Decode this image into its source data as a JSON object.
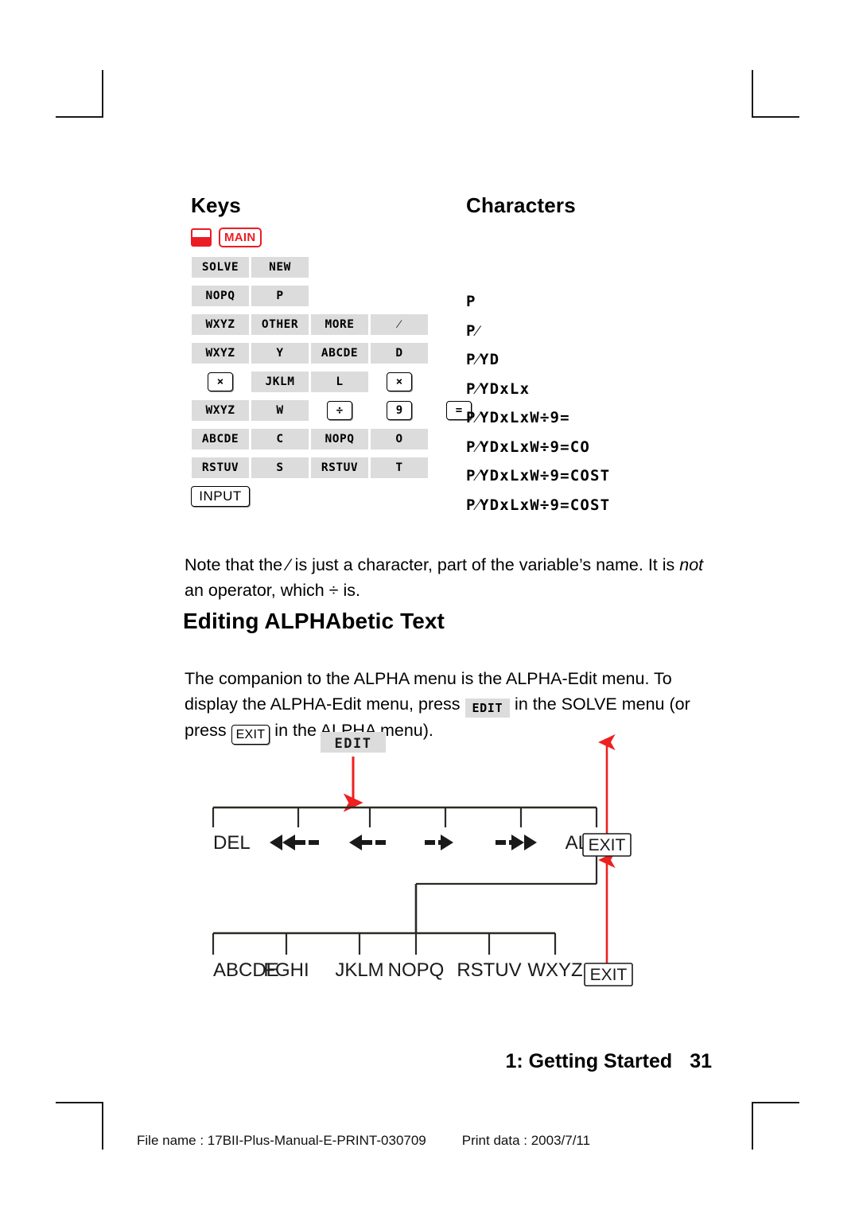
{
  "columns": {
    "keys_header": "Keys",
    "characters_header": "Characters"
  },
  "shift_row": {
    "shift_icon": "shift-indicator",
    "main_key": "MAIN"
  },
  "key_rows": [
    {
      "keys": [
        {
          "label": "SOLVE",
          "type": "soft"
        },
        {
          "label": "NEW",
          "type": "soft"
        }
      ],
      "character": ""
    },
    {
      "keys": [
        {
          "label": "NOPQ",
          "type": "soft"
        },
        {
          "label": "P",
          "type": "soft"
        }
      ],
      "character": "P"
    },
    {
      "keys": [
        {
          "label": "WXYZ",
          "type": "soft"
        },
        {
          "label": "OTHER",
          "type": "soft"
        },
        {
          "label": "MORE",
          "type": "soft"
        },
        {
          "label": "⁄",
          "type": "soft"
        }
      ],
      "character": "P⁄"
    },
    {
      "keys": [
        {
          "label": "WXYZ",
          "type": "soft"
        },
        {
          "label": "Y",
          "type": "soft"
        },
        {
          "label": "ABCDE",
          "type": "soft"
        },
        {
          "label": "D",
          "type": "soft"
        }
      ],
      "character": "P⁄YD"
    },
    {
      "keys": [
        {
          "label": "×",
          "type": "hard"
        },
        {
          "label": "JKLM",
          "type": "soft"
        },
        {
          "label": "L",
          "type": "soft"
        },
        {
          "label": "×",
          "type": "hard"
        }
      ],
      "character": "P⁄YDxLx"
    },
    {
      "keys": [
        {
          "label": "WXYZ",
          "type": "soft"
        },
        {
          "label": "W",
          "type": "soft"
        },
        {
          "label": "÷",
          "type": "hard"
        },
        {
          "label": "9",
          "type": "hard"
        },
        {
          "label": "=",
          "type": "hard"
        }
      ],
      "character": "P⁄YDxLxW÷9="
    },
    {
      "keys": [
        {
          "label": "ABCDE",
          "type": "soft"
        },
        {
          "label": "C",
          "type": "soft"
        },
        {
          "label": "NOPQ",
          "type": "soft"
        },
        {
          "label": "O",
          "type": "soft"
        }
      ],
      "character": "P⁄YDxLxW÷9=CO"
    },
    {
      "keys": [
        {
          "label": "RSTUV",
          "type": "soft"
        },
        {
          "label": "S",
          "type": "soft"
        },
        {
          "label": "RSTUV",
          "type": "soft"
        },
        {
          "label": "T",
          "type": "soft"
        }
      ],
      "character": "P⁄YDxLxW÷9=COST"
    },
    {
      "keys": [
        {
          "label": "INPUT",
          "type": "hardwide"
        }
      ],
      "character": "P⁄YDxLxW÷9=COST"
    }
  ],
  "note_paragraph": {
    "part1": "Note that the ",
    "slash": "⁄",
    "part2": " is just a character, part of the variable’s name. It is ",
    "italic": "not",
    "part3": " an operator, which ÷ is."
  },
  "section_heading": "Editing ALPHAbetic Text",
  "intro_paragraph": {
    "part1": "The companion to the ALPHA menu is the ALPHA-Edit menu. To display the ALPHA-Edit menu, press ",
    "edit_key": "EDIT",
    "part2": " in the SOLVE menu (or press ",
    "exit_key": "EXIT",
    "part3": " in the ALPHA menu)."
  },
  "diagram": {
    "entry_key": "EDIT",
    "top_menu": [
      "DEL",
      "◀◀--",
      "◀--",
      "--▶",
      "--▶▶",
      "ALPHA"
    ],
    "top_exit": "EXIT",
    "bottom_menu": [
      "ABCDE",
      "FGHI",
      "JKLM",
      "NOPQ",
      "RSTUV",
      "WXYZ"
    ],
    "bottom_exit": "EXIT",
    "arrow_color": "#ee2020",
    "line_color": "#2b2b24"
  },
  "footer": {
    "running_head": "1: Getting Started",
    "page_number": "31",
    "file_name": "File name : 17BII-Plus-Manual-E-PRINT-030709",
    "print_date": "Print data : 2003/7/11"
  }
}
